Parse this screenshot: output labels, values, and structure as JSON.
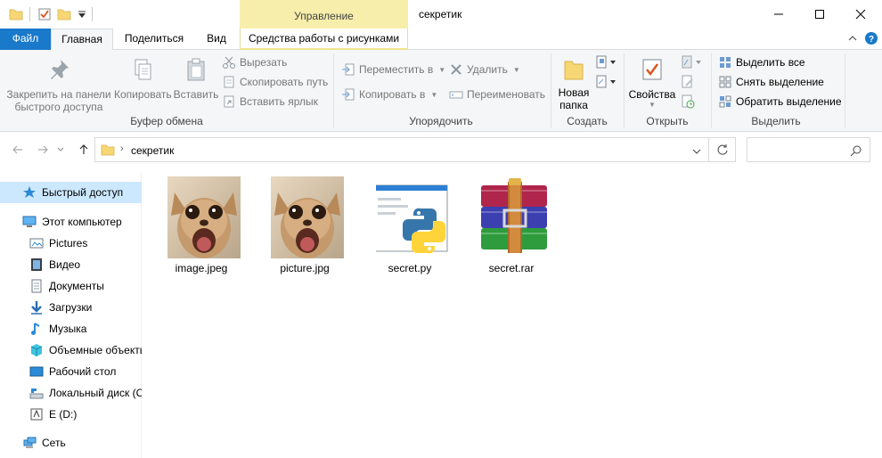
{
  "window": {
    "title": "секретик",
    "context_tab_header": "Управление"
  },
  "tabs": {
    "file": "Файл",
    "home": "Главная",
    "share": "Поделиться",
    "view": "Вид",
    "picture_tools": "Средства работы с рисунками"
  },
  "ribbon": {
    "clipboard": {
      "pin": "Закрепить на панели быстрого доступа",
      "pin_line1": "Закрепить на панели",
      "pin_line2": "быстрого доступа",
      "copy": "Копировать",
      "paste": "Вставить",
      "cut": "Вырезать",
      "copy_path": "Скопировать путь",
      "paste_shortcut": "Вставить ярлык",
      "label": "Буфер обмена"
    },
    "organize": {
      "move_to": "Переместить в",
      "copy_to": "Копировать в",
      "delete": "Удалить",
      "rename": "Переименовать",
      "label": "Упорядочить"
    },
    "new": {
      "new_folder_line1": "Новая",
      "new_folder_line2": "папка",
      "label": "Создать"
    },
    "open": {
      "properties": "Свойства",
      "label": "Открыть"
    },
    "select": {
      "select_all": "Выделить все",
      "select_none": "Снять выделение",
      "invert": "Обратить выделение",
      "label": "Выделить"
    }
  },
  "address": {
    "path": "секретик"
  },
  "sidebar": {
    "items": [
      {
        "label": "Быстрый доступ",
        "icon": "star-icon"
      },
      {
        "label": "Этот компьютер",
        "icon": "computer-icon"
      },
      {
        "label": "Pictures",
        "icon": "pictures-icon"
      },
      {
        "label": "Видео",
        "icon": "video-icon"
      },
      {
        "label": "Документы",
        "icon": "documents-icon"
      },
      {
        "label": "Загрузки",
        "icon": "downloads-icon"
      },
      {
        "label": "Музыка",
        "icon": "music-icon"
      },
      {
        "label": "Объемные объекты",
        "icon": "3d-objects-icon"
      },
      {
        "label": "Рабочий стол",
        "icon": "desktop-icon"
      },
      {
        "label": "Локальный диск (C:)",
        "icon": "local-disk-icon"
      },
      {
        "label": "E (D:)",
        "icon": "drive-icon"
      },
      {
        "label": "Сеть",
        "icon": "network-icon"
      }
    ]
  },
  "files": [
    {
      "name": "image.jpeg",
      "type": "image"
    },
    {
      "name": "picture.jpg",
      "type": "image"
    },
    {
      "name": "secret.py",
      "type": "python"
    },
    {
      "name": "secret.rar",
      "type": "rar"
    }
  ],
  "colors": {
    "accent": "#1979ca",
    "context_tab": "#f8eeac",
    "selected_nav": "#cce8ff"
  }
}
